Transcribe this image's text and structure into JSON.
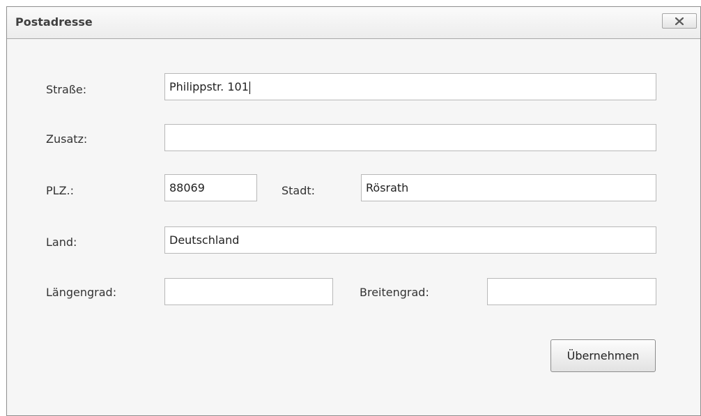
{
  "window": {
    "title": "Postadresse"
  },
  "form": {
    "street": {
      "label": "Straße:",
      "value": "Philippstr. 101"
    },
    "addition": {
      "label": "Zusatz:",
      "value": ""
    },
    "postal_code": {
      "label": "PLZ.:",
      "value": "88069"
    },
    "city": {
      "label": "Stadt:",
      "value": "Rösrath"
    },
    "country": {
      "label": "Land:",
      "value": "Deutschland"
    },
    "longitude": {
      "label": "Längengrad:",
      "value": ""
    },
    "latitude": {
      "label": "Breitengrad:",
      "value": ""
    }
  },
  "actions": {
    "apply_label": "Übernehmen"
  },
  "icons": {
    "close": "close-icon"
  },
  "colors": {
    "window_bg": "#f6f6f6",
    "field_border": "#b8b8b8",
    "text": "#333333"
  }
}
